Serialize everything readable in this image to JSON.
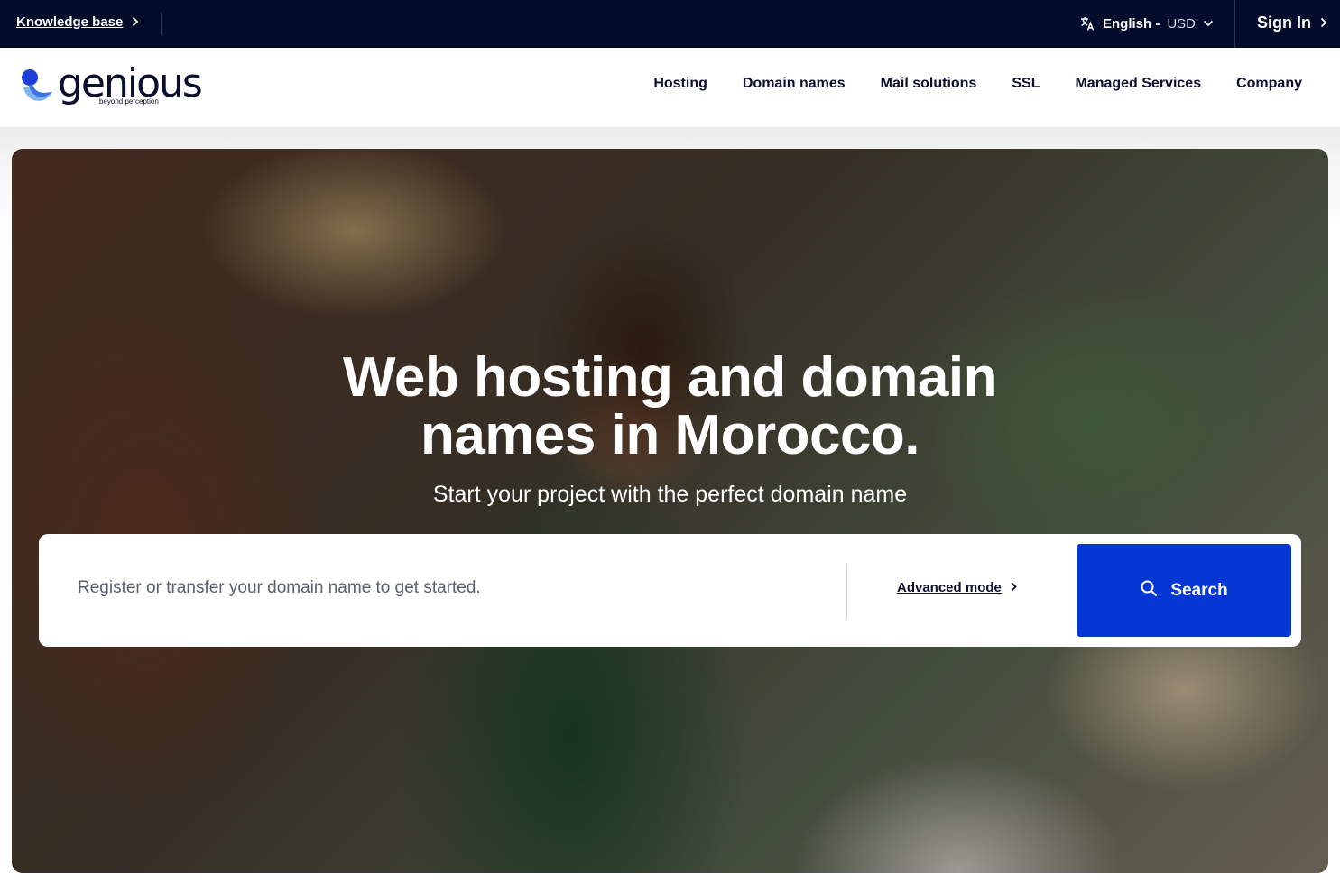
{
  "topbar": {
    "knowledge_base": "Knowledge base",
    "language": "English -",
    "currency": "USD",
    "sign_in": "Sign In"
  },
  "brand": {
    "name": "genious",
    "tagline": "beyond perception"
  },
  "nav": {
    "items": [
      "Hosting",
      "Domain names",
      "Mail solutions",
      "SSL",
      "Managed Services",
      "Company"
    ]
  },
  "hero": {
    "title_line1": "Web hosting and domain",
    "title_line2": "names in Morocco.",
    "subtitle": "Start your project with the perfect domain name"
  },
  "search": {
    "placeholder": "Register or transfer your domain name to get started.",
    "value": "",
    "advanced_mode": "Advanced mode",
    "button_label": "Search"
  },
  "icons": {
    "language": "translate-icon",
    "dropdown": "chevron-down-icon",
    "arrow": "chevron-right-icon",
    "search": "search-icon"
  },
  "colors": {
    "topbar_bg": "#030c2b",
    "primary_button": "#0437d3",
    "logo_blue": "#1e40d6",
    "text_dark": "#0b0f2e"
  }
}
